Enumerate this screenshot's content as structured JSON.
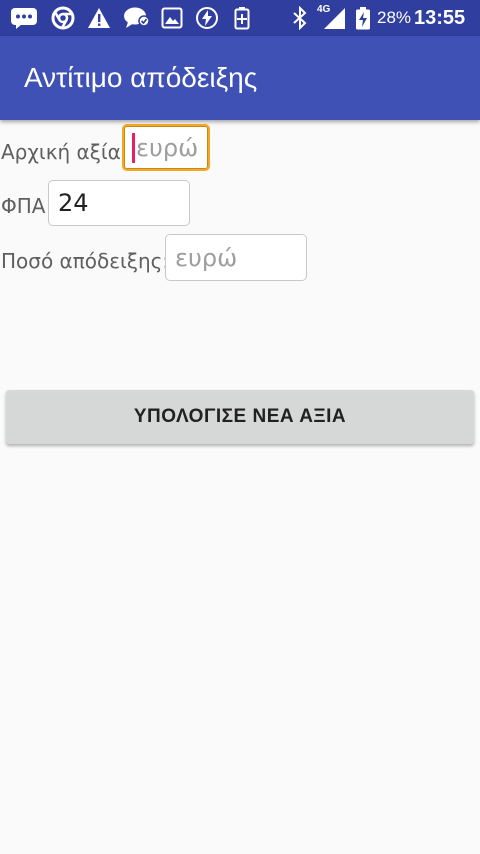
{
  "status_bar": {
    "battery_percent": "28%",
    "time": "13:55",
    "network": "4G",
    "icons": [
      "messages-icon",
      "chrome-icon",
      "warning-icon",
      "chat-icon",
      "gallery-icon",
      "power-icon",
      "battery-saver-icon",
      "bluetooth-icon",
      "signal-icon",
      "battery-charging-icon"
    ]
  },
  "app_bar": {
    "title": "Αντίτιμο απόδειξης"
  },
  "form": {
    "initial_value": {
      "label": "Αρχική αξία:",
      "placeholder": "ευρώ",
      "value": ""
    },
    "vat": {
      "label": "ΦΠΑ",
      "value": "24"
    },
    "receipt_amount": {
      "label": "Ποσό απόδειξης:",
      "placeholder": "ευρώ",
      "value": ""
    }
  },
  "actions": {
    "calculate_label": "ΥΠΟΛΟΓΙΣΕ ΝΕΑ ΑΞΙΑ"
  },
  "colors": {
    "status_bar": "#303f9f",
    "app_bar": "#3f51b5",
    "focus_border": "#f5a623",
    "caret": "#e91e63",
    "button": "#d6d7d7"
  }
}
